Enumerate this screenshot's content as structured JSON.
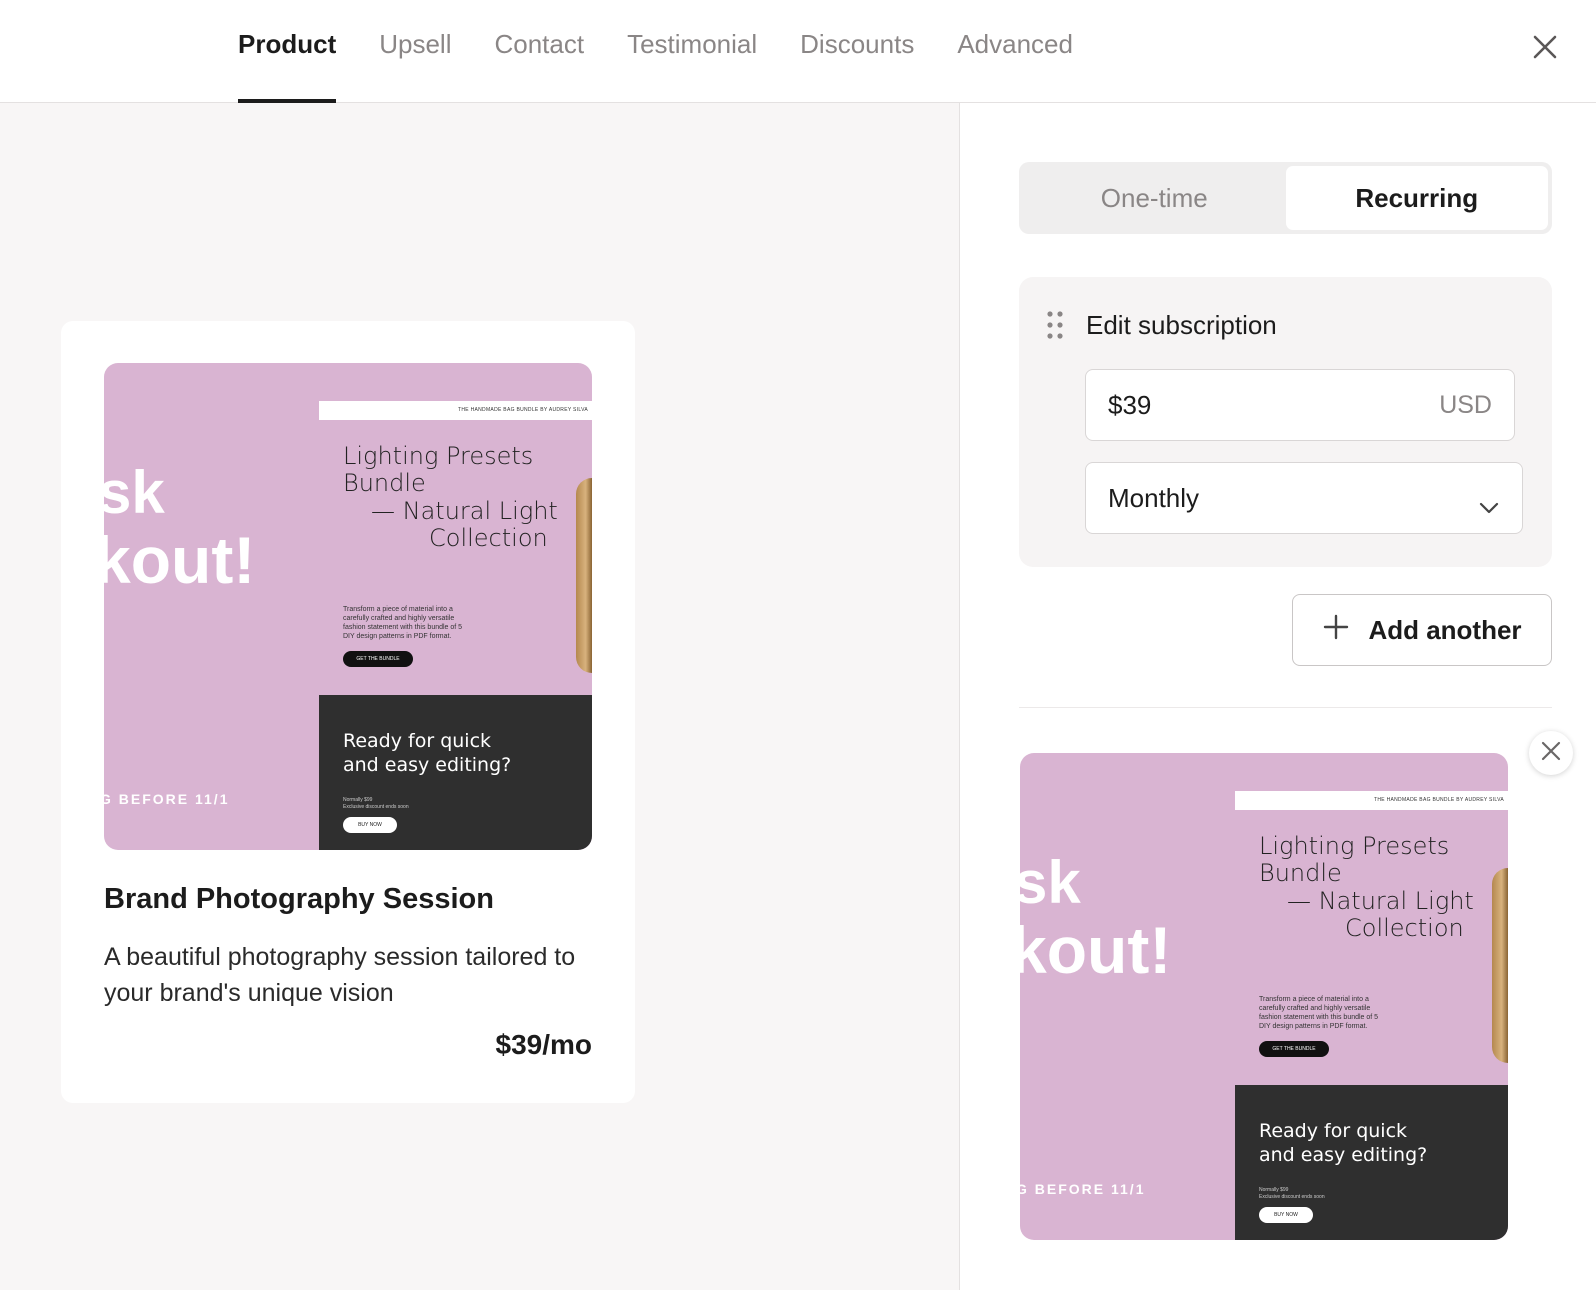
{
  "nav": {
    "tabs": [
      {
        "label": "Product",
        "active": true
      },
      {
        "label": "Upsell",
        "active": false
      },
      {
        "label": "Contact",
        "active": false
      },
      {
        "label": "Testimonial",
        "active": false
      },
      {
        "label": "Discounts",
        "active": false
      },
      {
        "label": "Advanced",
        "active": false
      }
    ],
    "close_icon": "close-icon"
  },
  "preview": {
    "image": {
      "big_text_line1": "sk",
      "big_text_line2": "kout!",
      "before_text": "G BEFORE 11/1",
      "page_header": "THE HANDMADE BAG BUNDLE BY AUDREY SILVA",
      "heading_line1": "Lighting Presets",
      "heading_line2": "Bundle",
      "heading_line3": "— Natural Light",
      "heading_line4": "Collection",
      "small_line1": "Transform a piece of material into a",
      "small_line2": "carefully crafted and highly versatile",
      "small_line3": "fashion statement with this bundle of 5",
      "small_line4": "DIY design patterns in PDF format.",
      "pill_label": "GET THE BUNDLE",
      "dark_line1": "Ready for quick",
      "dark_line2": "and easy editing?",
      "dark_small1": "Normally $99",
      "dark_small2": "Exclusive discount ends soon",
      "dark_pill": "BUY NOW"
    },
    "title": "Brand Photography Session",
    "description": "A beautiful photography session tailored to your brand's unique vision",
    "price": "$39/mo"
  },
  "settings": {
    "pricing_type": {
      "options": [
        "One-time",
        "Recurring"
      ],
      "selected": "Recurring"
    },
    "subscription": {
      "label": "Edit subscription",
      "price_value": "$39",
      "currency": "USD",
      "interval": "Monthly"
    },
    "add_another_label": "Add another"
  },
  "colors": {
    "accent": "#1c1c1c",
    "muted": "#8a8686",
    "preview_bg": "#f8f6f6",
    "image_pink": "#d9b4d2",
    "image_dark": "#2f2f2f"
  }
}
